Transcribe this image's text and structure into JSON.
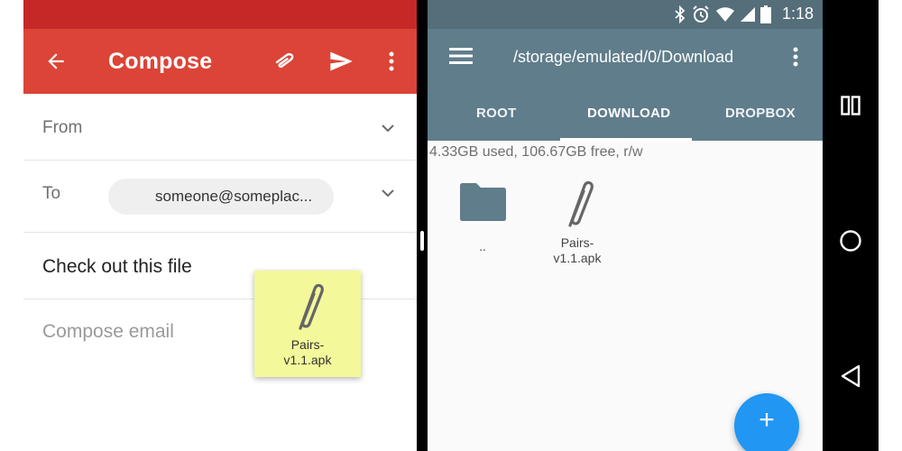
{
  "compose": {
    "title": "Compose",
    "from_label": "From",
    "to_label": "To",
    "to_chip": "someone@someplac...",
    "subject": "Check out this file",
    "body_placeholder": "Compose email"
  },
  "drag_item": {
    "name_line1": "Pairs-",
    "name_line2": "v1.1.apk"
  },
  "file_manager": {
    "status_time": "1:18",
    "path": "/storage/emulated/0/Download",
    "tabs": [
      {
        "label": "ROOT"
      },
      {
        "label": "DOWNLOAD"
      },
      {
        "label": "DROPBOX"
      }
    ],
    "active_tab": "DOWNLOAD",
    "storage_info": "4.33GB used, 106.67GB free, r/w",
    "items": [
      {
        "label": "..",
        "icon": "folder-icon"
      },
      {
        "label_line1": "Pairs-",
        "label_line2": "v1.1.apk",
        "icon": "paperclip-icon"
      }
    ],
    "fab_label": "+"
  },
  "colors": {
    "compose_red": "#db4437",
    "status_red": "#c62828",
    "fm_bluegrey": "#607d8b",
    "fab_blue": "#2196f3",
    "drag_yellow": "#f3f89a"
  }
}
